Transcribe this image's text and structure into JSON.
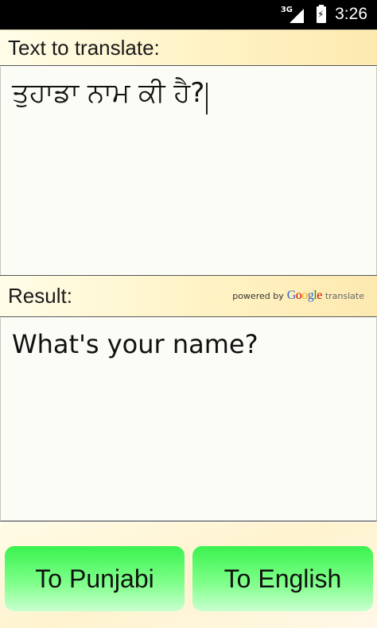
{
  "status_bar": {
    "network": "3G",
    "time": "3:26"
  },
  "translate_section": {
    "header_label": "Text to translate:",
    "input_value": "ਤੁਹਾਡਾ ਨਾਮ ਕੀ ਹੈ?"
  },
  "result_section": {
    "header_label": "Result:",
    "powered_by": "powered by",
    "google_letters": [
      "G",
      "o",
      "o",
      "g",
      "l",
      "e"
    ],
    "translate_word": "translate",
    "result_value": "What's your name?"
  },
  "buttons": {
    "to_punjabi": "To Punjabi",
    "to_english": "To English"
  },
  "colors": {
    "button_green": "#3af24f",
    "header_bg": "#fff2c2"
  }
}
